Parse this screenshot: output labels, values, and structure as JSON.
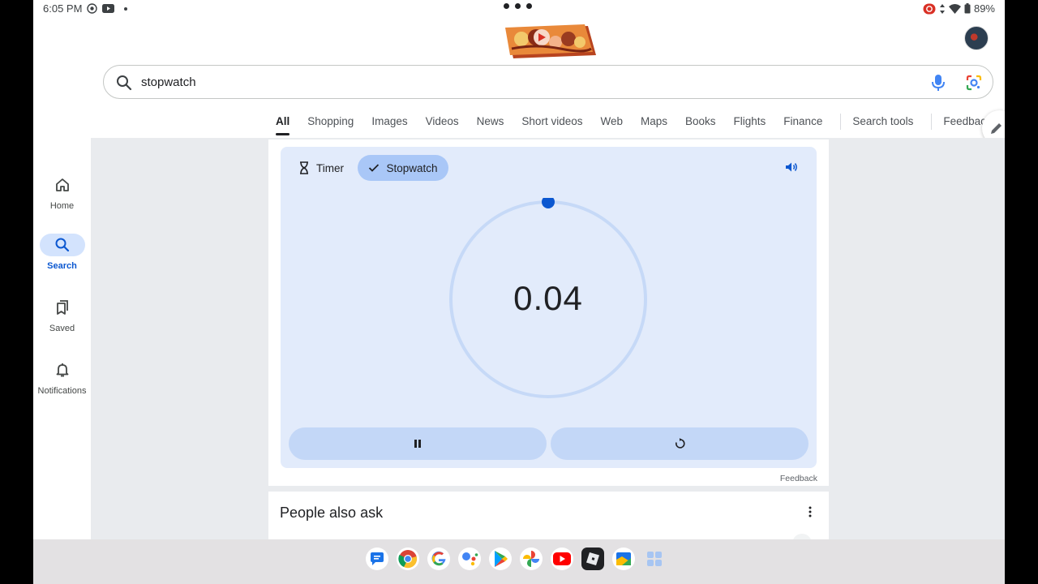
{
  "status_bar": {
    "time": "6:05 PM",
    "battery": "89%",
    "left_icons": [
      "focus-icon",
      "youtube-notification-icon"
    ],
    "right_icons": [
      "screen-record-icon",
      "signal-icon",
      "wifi-icon",
      "battery-icon"
    ]
  },
  "search": {
    "query": "stopwatch"
  },
  "tabs": [
    {
      "label": "All",
      "active": true
    },
    {
      "label": "Shopping"
    },
    {
      "label": "Images"
    },
    {
      "label": "Videos"
    },
    {
      "label": "News"
    },
    {
      "label": "Short videos"
    },
    {
      "label": "Web"
    },
    {
      "label": "Maps"
    },
    {
      "label": "Books"
    },
    {
      "label": "Flights"
    },
    {
      "label": "Finance"
    },
    {
      "label": "Search tools"
    },
    {
      "label": "Feedback"
    }
  ],
  "rail": {
    "home": "Home",
    "search": "Search",
    "saved": "Saved",
    "notifications": "Notifications"
  },
  "stopwatch": {
    "timer_label": "Timer",
    "stopwatch_label": "Stopwatch",
    "time": "0.04",
    "feedback": "Feedback"
  },
  "people_also_ask": {
    "title": "People also ask"
  },
  "dock": {
    "apps": [
      "messages-icon",
      "chrome-icon",
      "google-icon",
      "assistant-icon",
      "play-store-icon",
      "photos-icon",
      "youtube-icon",
      "roblox-icon",
      "files-icon",
      "app-drawer-icon"
    ]
  },
  "colors": {
    "accent": "#0b57d0",
    "widget_bg": "#e2ebfb",
    "chip_active": "#a9c7f7",
    "button_bg": "#c3d7f7"
  }
}
